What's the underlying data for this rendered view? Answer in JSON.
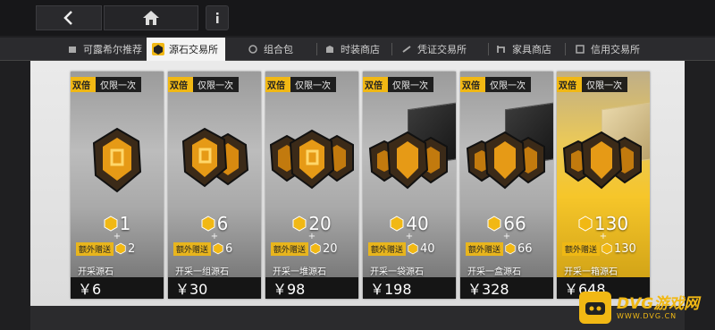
{
  "tabs": [
    {
      "label": "可露希尔推荐",
      "icon": "recommend-icon",
      "active": false
    },
    {
      "label": "源石交易所",
      "icon": "originite-icon",
      "active": true
    },
    {
      "label": "组合包",
      "icon": "bundle-icon",
      "active": false
    },
    {
      "label": "时装商店",
      "icon": "outfit-icon",
      "active": false
    },
    {
      "label": "凭证交易所",
      "icon": "voucher-icon",
      "active": false
    },
    {
      "label": "家具商店",
      "icon": "furniture-icon",
      "active": false
    },
    {
      "label": "信用交易所",
      "icon": "credit-icon",
      "active": false
    }
  ],
  "tag": {
    "double": "双倍",
    "once": "仅限一次"
  },
  "bonus_label": "额外赠送",
  "plus": "+",
  "cards": [
    {
      "amount": "1",
      "bonus": "2",
      "name": "开采源石",
      "price": "￥6"
    },
    {
      "amount": "6",
      "bonus": "6",
      "name": "开采一组源石",
      "price": "￥30"
    },
    {
      "amount": "20",
      "bonus": "20",
      "name": "开采一堆源石",
      "price": "￥98"
    },
    {
      "amount": "40",
      "bonus": "40",
      "name": "开采一袋源石",
      "price": "￥198"
    },
    {
      "amount": "66",
      "bonus": "66",
      "name": "开采一盒源石",
      "price": "￥328"
    },
    {
      "amount": "130",
      "bonus": "130",
      "name": "开采一箱源石",
      "price": "￥648"
    }
  ],
  "watermark": {
    "main": "DVG游戏网",
    "sub": "WWW.DVG.CN"
  },
  "colors": {
    "accent": "#f1b814",
    "dark": "#1f1f21"
  }
}
